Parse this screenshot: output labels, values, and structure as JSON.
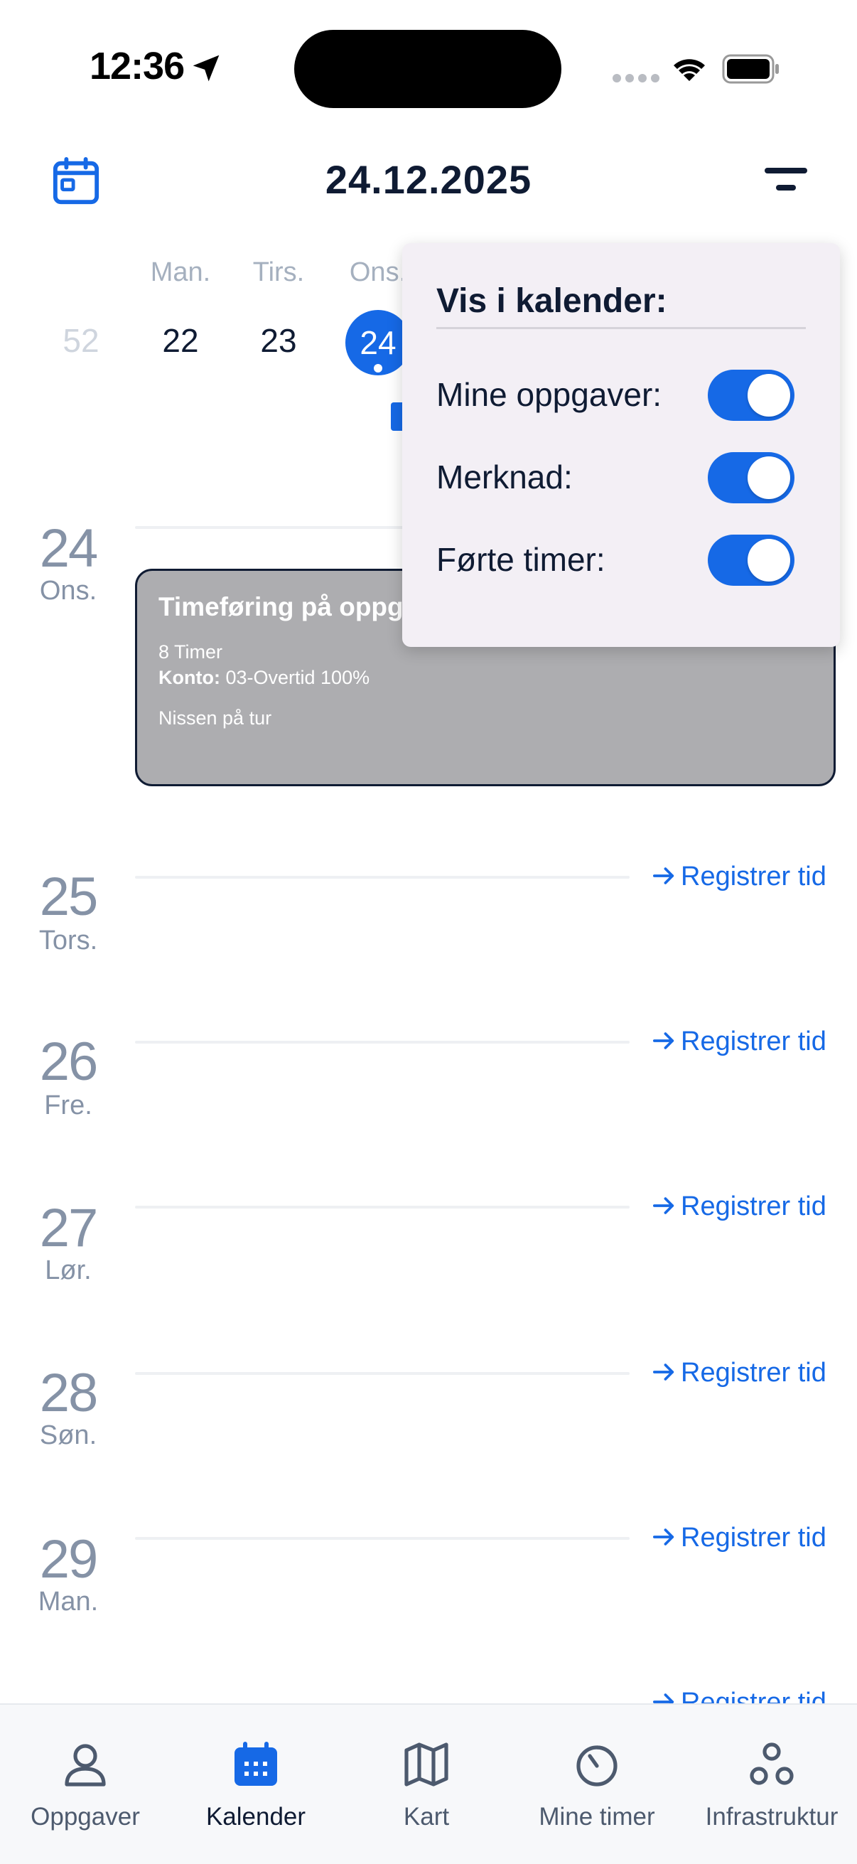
{
  "status_bar": {
    "time": "12:36"
  },
  "header": {
    "date": "24.12.2025"
  },
  "week": {
    "weekdays": [
      "Man.",
      "Tirs.",
      "Ons."
    ],
    "week_number": "52",
    "days": [
      "22",
      "23",
      "24"
    ],
    "selected_day": "24"
  },
  "days": [
    {
      "num": "24",
      "name": "Ons."
    },
    {
      "num": "25",
      "name": "Tors."
    },
    {
      "num": "26",
      "name": "Fre."
    },
    {
      "num": "27",
      "name": "Lør."
    },
    {
      "num": "28",
      "name": "Søn."
    },
    {
      "num": "29",
      "name": "Man."
    }
  ],
  "register_label": "Registrer tid",
  "event": {
    "title": "Timeføring på oppgave Lagertelling Hovedlager",
    "hours": "8 Timer",
    "account_label": "Konto:",
    "account_value": "03-Overtid 100%",
    "note": "Nissen på tur"
  },
  "popover": {
    "title": "Vis i kalender:",
    "options": [
      {
        "label": "Mine oppgaver:",
        "on": true
      },
      {
        "label": "Merknad:",
        "on": true
      },
      {
        "label": "Førte timer:",
        "on": true
      }
    ]
  },
  "tabs": [
    {
      "label": "Oppgaver",
      "icon": "person-icon"
    },
    {
      "label": "Kalender",
      "icon": "calendar-icon",
      "active": true
    },
    {
      "label": "Kart",
      "icon": "map-icon"
    },
    {
      "label": "Mine timer",
      "icon": "timer-icon"
    },
    {
      "label": "Infrastruktur",
      "icon": "nodes-icon"
    }
  ],
  "colors": {
    "accent": "#1669e6",
    "text": "#0f1b33",
    "muted": "#8592a6",
    "event_bg": "#adadb0",
    "popover_bg": "#f3eff5"
  }
}
